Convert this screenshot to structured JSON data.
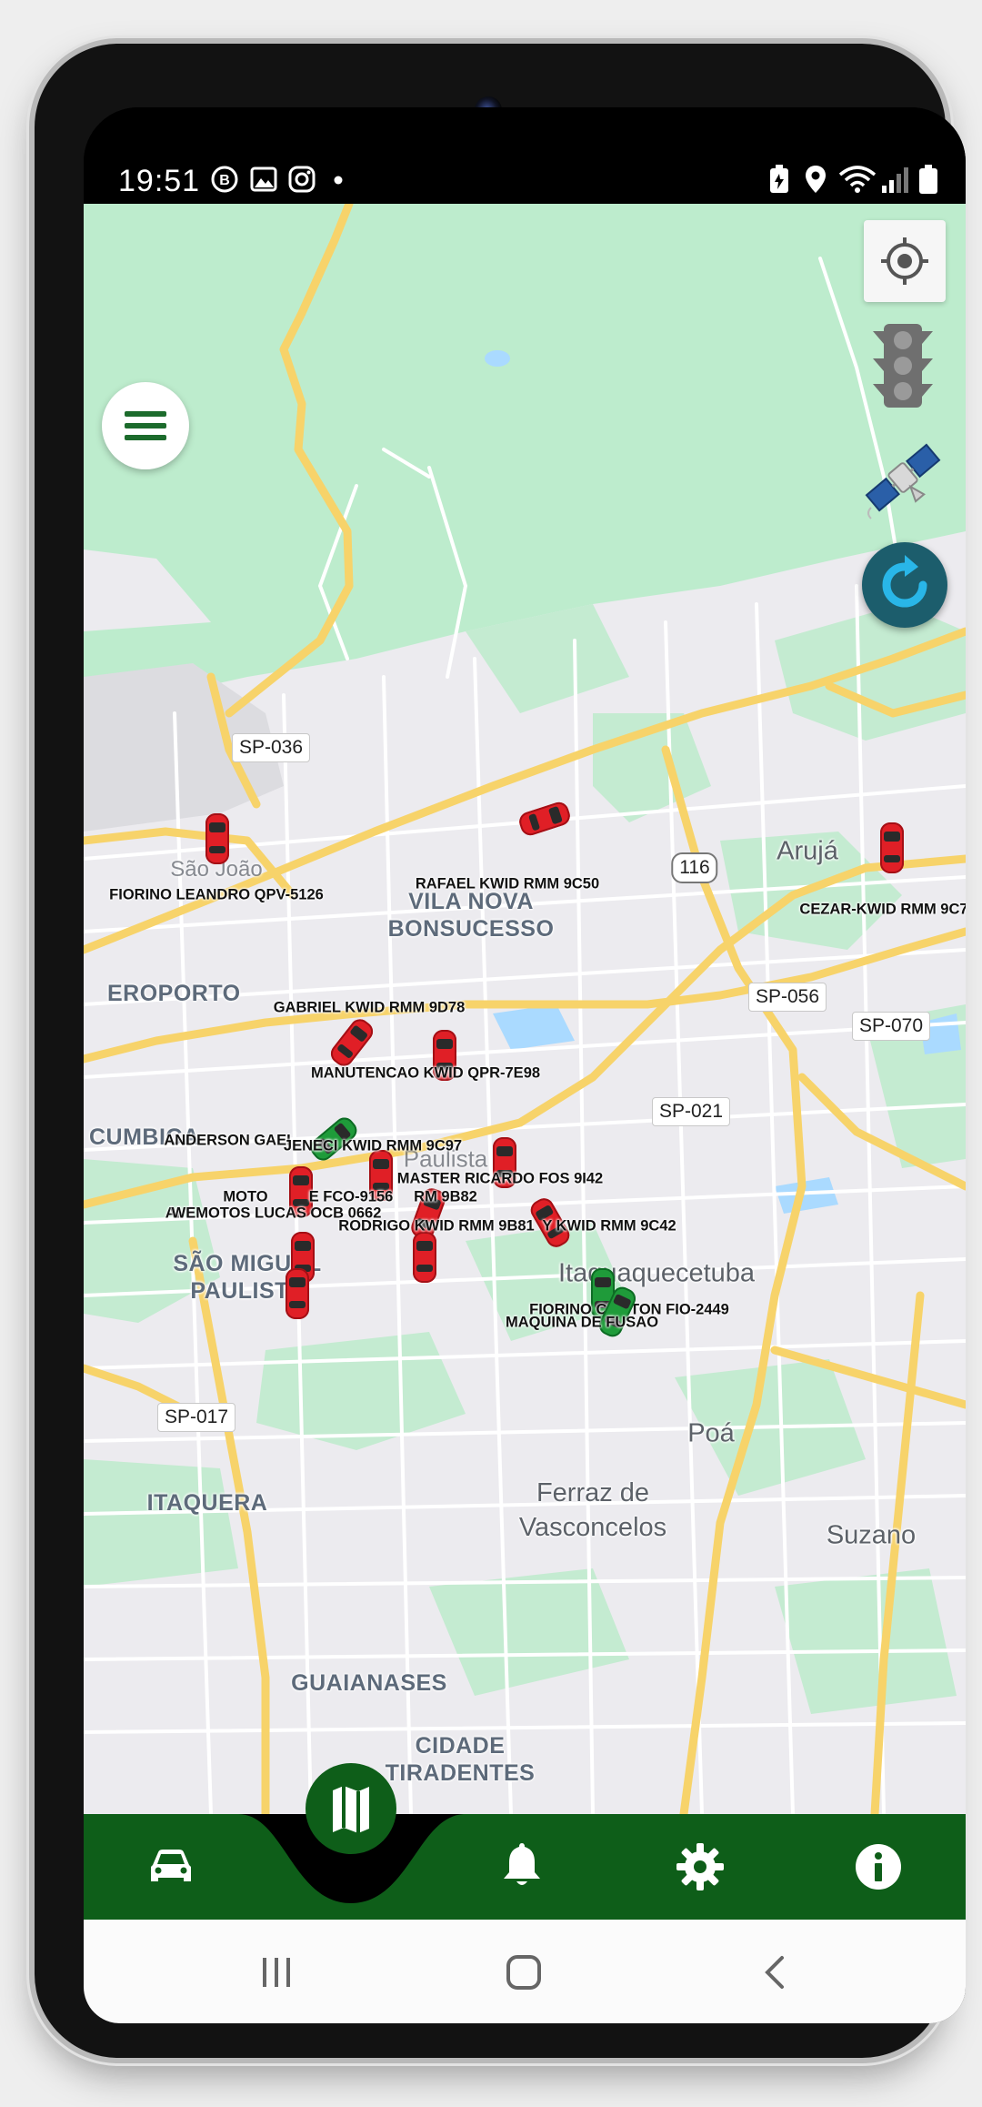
{
  "status_bar": {
    "time": "19:51",
    "notification_icons": [
      "b-circle-icon",
      "image-icon",
      "instagram-icon",
      "dot-icon"
    ],
    "system_icons": [
      "battery-saver-icon",
      "location-icon",
      "wifi-icon",
      "signal-icon",
      "battery-icon"
    ]
  },
  "map": {
    "places": [
      {
        "text": "VILA NOVA\nBONSUCESSO",
        "kind": "area"
      },
      {
        "text": "Arujá",
        "kind": "big"
      },
      {
        "text": "EROPORTO",
        "kind": "area"
      },
      {
        "text": "CUMBICA",
        "kind": "area"
      },
      {
        "text": "SÃO MIGUEL\nPAULISTA",
        "kind": "area"
      },
      {
        "text": "Itaquaquecetuba",
        "kind": "big"
      },
      {
        "text": "Poá",
        "kind": "big"
      },
      {
        "text": "Ferraz de\nVasconcelos",
        "kind": "big"
      },
      {
        "text": "Suzano",
        "kind": "big"
      },
      {
        "text": "ITAQUERA",
        "kind": "area"
      },
      {
        "text": "GUAIANASES",
        "kind": "area"
      },
      {
        "text": "CIDADE\nTIRADENTES",
        "kind": "area"
      },
      {
        "text": "São João",
        "kind": "big"
      },
      {
        "text": "Paulista",
        "kind": "big"
      }
    ],
    "road_shields": [
      "SP-036",
      "116",
      "SP-056",
      "SP-070",
      "SP-021",
      "SP-017"
    ],
    "vehicles": [
      {
        "label": "FIORINO LEANDRO QPV-5126",
        "status": "red"
      },
      {
        "label": "RAFAEL KWID RMM 9C50",
        "status": "red"
      },
      {
        "label": "CEZAR-KWID RMM 9C7",
        "status": "red"
      },
      {
        "label": "GABRIEL KWID RMM 9D78",
        "status": "red"
      },
      {
        "label": "MANUTENCAO KWID QPR-7E98",
        "status": "red"
      },
      {
        "label": "ANDERSON GAEI",
        "status": "green"
      },
      {
        "label": "JENECI KWID RMM 9C97",
        "status": "red"
      },
      {
        "label": "MASTER RICARDO FOS 9I42",
        "status": "red"
      },
      {
        "label": "MOTO",
        "status": "red"
      },
      {
        "label": "E FCO-9156",
        "status": "red"
      },
      {
        "label": "RM 9B82",
        "status": "red"
      },
      {
        "label": "AI",
        "status": "red"
      },
      {
        "label": "WEMOTOS LUCAS OCB 0662",
        "status": "red"
      },
      {
        "label": "RODRIGO KWID RMM 9B81",
        "status": "red"
      },
      {
        "label": "Y KWID RMM 9C42",
        "status": "red"
      },
      {
        "label": "FIORINO CLEITON FIO-2449",
        "status": "green"
      },
      {
        "label": "MAQUINA DE FUSAO",
        "status": "green"
      }
    ]
  },
  "controls": {
    "menu": "menu-icon",
    "locate": "crosshair-icon",
    "traffic": "traffic-light-icon",
    "satellite": "satellite-icon",
    "refresh": "refresh-icon"
  },
  "bottom_nav": {
    "items": [
      "car-icon",
      "map-icon",
      "bell-icon",
      "gear-icon",
      "info-icon"
    ],
    "active": "map-icon",
    "color": "#0e5e19"
  },
  "system_nav": [
    "recent-apps-icon",
    "home-icon",
    "back-icon"
  ]
}
